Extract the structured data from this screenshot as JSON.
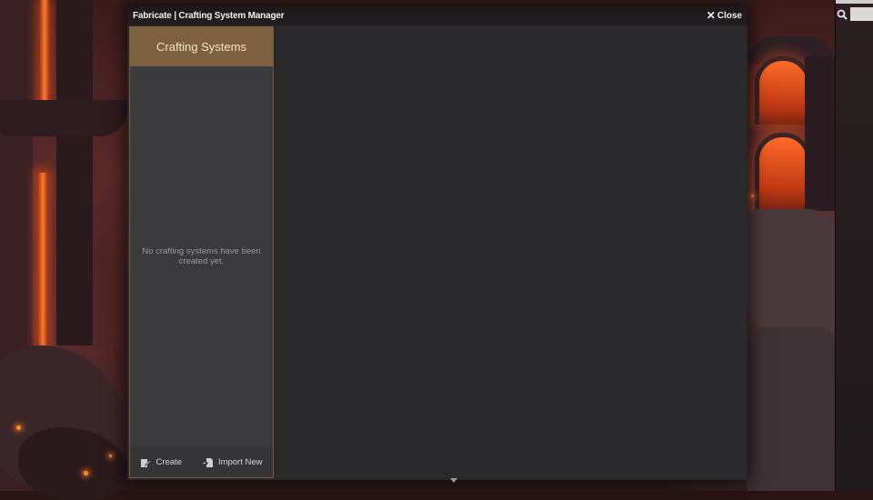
{
  "window": {
    "title": "Fabricate | Crafting System Manager",
    "close_label": "Close"
  },
  "sidebar": {
    "header": "Crafting Systems",
    "empty_message": "No crafting systems have been created yet.",
    "create_label": "Create",
    "import_label": "Import New"
  },
  "icons": {
    "close": "close-icon",
    "create": "create-icon",
    "import": "import-icon",
    "search": "search-icon"
  },
  "colors": {
    "sidebar_header_bg": "#7d6040",
    "sidebar_border": "#7a5d3c",
    "window_bg": "#29272a"
  }
}
